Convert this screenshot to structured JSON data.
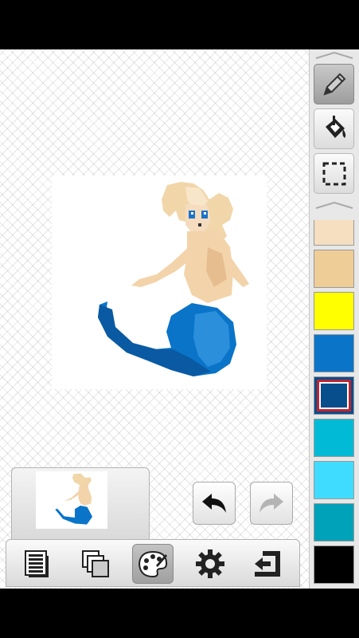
{
  "toolbar": {
    "tools": [
      {
        "name": "pencil-icon",
        "active": true
      },
      {
        "name": "paint-bucket-icon",
        "active": false
      },
      {
        "name": "selection-icon",
        "active": false
      }
    ]
  },
  "palette": {
    "colors": [
      "#f5dfc0",
      "#efcd97",
      "#ffff00",
      "#0a74c8",
      "#084e8c",
      "#00bad6",
      "#3fdcff",
      "#00a2b9",
      "#000000"
    ],
    "selected_index": 4
  },
  "history": {
    "undo_icon": "undo-arrow-icon",
    "redo_icon": "redo-arrow-icon",
    "redo_enabled": false
  },
  "bottom_bar": {
    "buttons": [
      {
        "name": "layers-icon",
        "active": false
      },
      {
        "name": "frames-icon",
        "active": false
      },
      {
        "name": "palette-icon",
        "active": true
      },
      {
        "name": "settings-gear-icon",
        "active": false
      },
      {
        "name": "export-icon",
        "active": false
      }
    ]
  }
}
